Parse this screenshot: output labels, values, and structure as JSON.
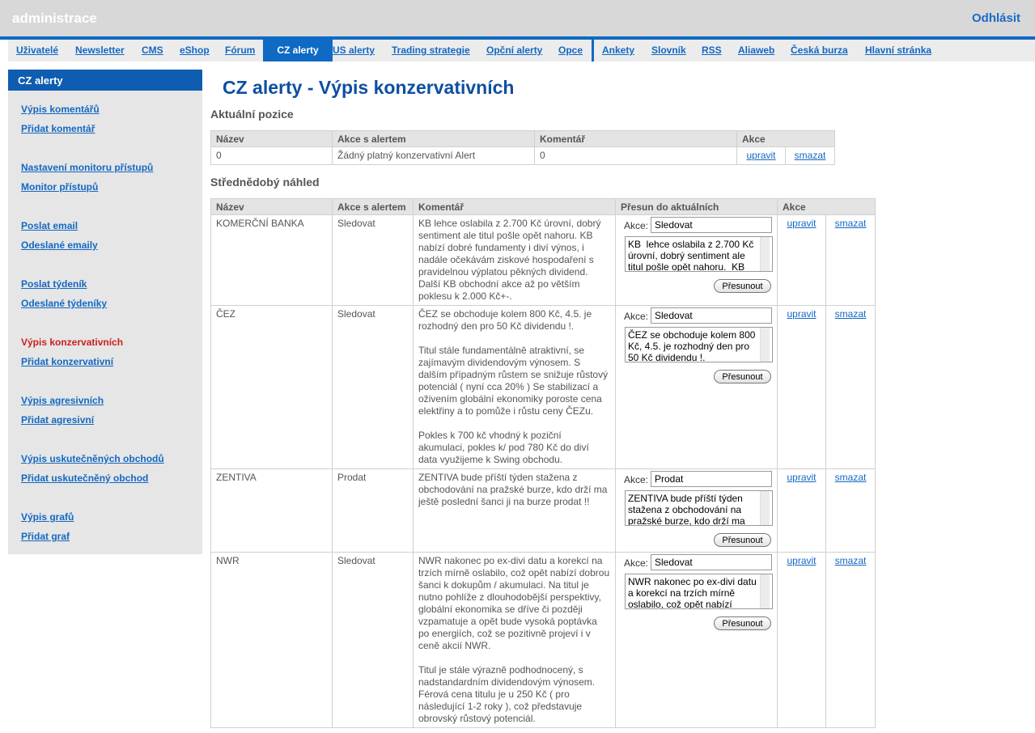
{
  "header": {
    "brand": "administrace",
    "logout": "Odhlásit"
  },
  "nav": {
    "items": [
      "Uživatelé",
      "Newsletter",
      "CMS",
      "eShop",
      "Fórum",
      "CZ alerty",
      "US alerty",
      "Trading strategie",
      "Opční alerty",
      "Opce",
      "Ankety",
      "Slovník",
      "RSS",
      "Aliaweb",
      "Česká burza",
      "Hlavní stránka"
    ],
    "active": "CZ alerty"
  },
  "sidebar": {
    "title": "CZ alerty",
    "items": [
      "Výpis komentářů",
      "Přidat komentář",
      "Nastavení monitoru přístupů",
      "Monitor přístupů",
      "Poslat email",
      "Odeslané emaily",
      "Poslat týdeník",
      "Odeslané týdeníky",
      "Výpis konzervativních",
      "Přidat konzervativní",
      "Výpis agresivních",
      "Přidat agresivní",
      "Výpis uskutečněných obchodů",
      "Přidat uskutečněný obchod",
      "Výpis grafů",
      "Přidat graf"
    ],
    "current": "Výpis konzervativních"
  },
  "page": {
    "title": "CZ alerty - Výpis konzervativních",
    "current_section": "Aktuální pozice",
    "medium_section": "Střednědobý náhled"
  },
  "current_table": {
    "headers": [
      "Název",
      "Akce s alertem",
      "Komentář",
      "Akce"
    ],
    "rows": [
      {
        "name": "0",
        "action": "Žádný platný konzervativní Alert",
        "comment": "0",
        "edit": "upravit",
        "delete": "smazat"
      }
    ]
  },
  "medium_table": {
    "headers": [
      "Název",
      "Akce s alertem",
      "Komentář",
      "Přesun do aktuálních",
      "Akce"
    ],
    "akce_label": "Akce:",
    "move_button": "Přesunout",
    "edit_label": "upravit",
    "delete_label": "smazat",
    "rows": [
      {
        "name": "KOMERČNÍ BANKA",
        "action": "Sledovat",
        "comment": [
          "KB lehce oslabila z 2.700 Kč úrovní, dobrý sentiment ale titul pošle opět nahoru. KB nabízí dobré fundamenty i diví výnos, i nadále očekávám ziskové hospodaření s pravidelnou výplatou pěkných dividend. Další KB obchodní akce až po větším poklesu k 2.000 Kč+-."
        ],
        "move_action": "Sledovat",
        "move_text": "KB  lehce oslabila z 2.700 Kč úrovní, dobrý sentiment ale titul pošle opět nahoru.  KB"
      },
      {
        "name": "ČEZ",
        "action": "Sledovat",
        "comment": [
          "ČEZ se obchoduje kolem 800 Kč, 4.5. je rozhodný den pro 50 Kč dividendu !.",
          "Titul stále fundamentálně atraktivní, se zajímavým dividendovým výnosem. S dalším případným růstem se snižuje růstový potenciál ( nyní cca 20% ) Se stabilizací a oživením globální ekonomiky poroste cena elektřiny a to pomůže i růstu ceny ČEZu.",
          "Pokles k 700 kč vhodný k poziční akumulaci, pokles k/ pod 780 Kč do diví data využijeme k Swing obchodu."
        ],
        "move_action": "Sledovat",
        "move_text": "ČEZ se obchoduje kolem 800 Kč, 4.5. je rozhodný den pro 50 Kč dividendu !."
      },
      {
        "name": "ZENTIVA",
        "action": "Prodat",
        "comment": [
          "ZENTIVA bude příští týden stažena z obchodování na pražské burze, kdo drží ma ještě poslední šanci ji na burze prodat !!"
        ],
        "move_action": "Prodat",
        "move_text": "ZENTIVA bude příští týden stažena z obchodování na pražské burze, kdo drží ma"
      },
      {
        "name": "NWR",
        "action": "Sledovat",
        "comment": [
          "NWR nakonec po ex-divi datu a korekcí na trzích mírně oslabilo, což opět nabízí dobrou šanci k dokupům / akumulaci. Na titul je nutno pohlíže z dlouhodobější perspektivy, globální ekonomika se dříve či později vzpamatuje a opět bude vysoká poptávka po energiích, což se pozitivně projeví i v ceně akcií NWR.",
          "Titul je stále výrazně podhodnocený, s nadstandardním dividendovým výnosem. Férová cena titulu je u 250 Kč ( pro následující 1-2 roky ), což představuje obrovský růstový potenciál."
        ],
        "move_action": "Sledovat",
        "move_text": "NWR nakonec po ex-divi datu a korekcí na trzích mírně oslabilo, což opět nabízí"
      }
    ]
  }
}
